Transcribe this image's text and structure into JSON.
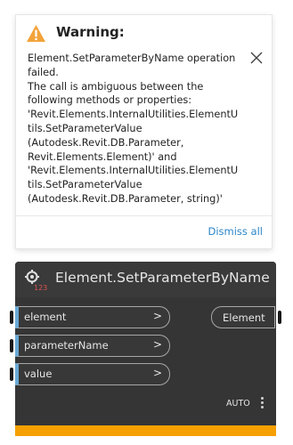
{
  "warning": {
    "title": "Warning:",
    "message": "Element.SetParameterByName operation\nfailed.\nThe call is ambiguous between the\nfollowing methods or properties:\n'Revit.Elements.InternalUtilities.ElementU\ntils.SetParameterValue\n(Autodesk.Revit.DB.Parameter,\nRevit.Elements.Element)' and\n'Revit.Elements.InternalUtilities.ElementU\ntils.SetParameterValue\n(Autodesk.Revit.DB.Parameter, string)'",
    "dismiss_label": "Dismiss all",
    "icon": "warning-triangle-icon",
    "icon_color": "#f2a33a"
  },
  "node": {
    "title": "Element.SetParameterByName",
    "icon": "node-method-icon",
    "inputs": [
      {
        "label": "element",
        "chevron": ">"
      },
      {
        "label": "parameterName",
        "chevron": ">"
      },
      {
        "label": "value",
        "chevron": ">"
      }
    ],
    "output": {
      "label": "Element"
    },
    "lacing": "AUTO",
    "colors": {
      "header": "#3a3a3a",
      "body": "#353535",
      "port_accent": "#6aa9d6",
      "warning_bar": "#f5a000"
    }
  }
}
